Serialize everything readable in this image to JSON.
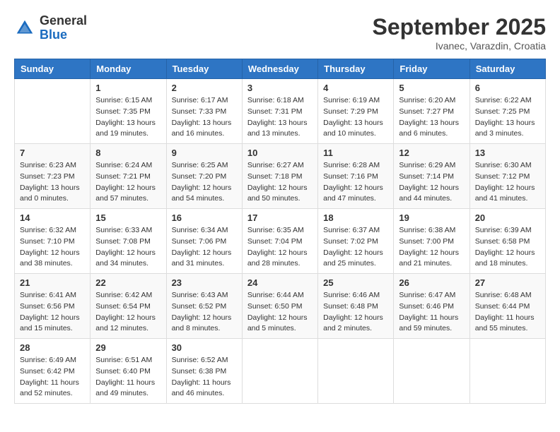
{
  "header": {
    "logo_general": "General",
    "logo_blue": "Blue",
    "month_title": "September 2025",
    "subtitle": "Ivanec, Varazdin, Croatia"
  },
  "weekdays": [
    "Sunday",
    "Monday",
    "Tuesday",
    "Wednesday",
    "Thursday",
    "Friday",
    "Saturday"
  ],
  "weeks": [
    [
      {
        "day": "",
        "info": ""
      },
      {
        "day": "1",
        "info": "Sunrise: 6:15 AM\nSunset: 7:35 PM\nDaylight: 13 hours\nand 19 minutes."
      },
      {
        "day": "2",
        "info": "Sunrise: 6:17 AM\nSunset: 7:33 PM\nDaylight: 13 hours\nand 16 minutes."
      },
      {
        "day": "3",
        "info": "Sunrise: 6:18 AM\nSunset: 7:31 PM\nDaylight: 13 hours\nand 13 minutes."
      },
      {
        "day": "4",
        "info": "Sunrise: 6:19 AM\nSunset: 7:29 PM\nDaylight: 13 hours\nand 10 minutes."
      },
      {
        "day": "5",
        "info": "Sunrise: 6:20 AM\nSunset: 7:27 PM\nDaylight: 13 hours\nand 6 minutes."
      },
      {
        "day": "6",
        "info": "Sunrise: 6:22 AM\nSunset: 7:25 PM\nDaylight: 13 hours\nand 3 minutes."
      }
    ],
    [
      {
        "day": "7",
        "info": "Sunrise: 6:23 AM\nSunset: 7:23 PM\nDaylight: 13 hours\nand 0 minutes."
      },
      {
        "day": "8",
        "info": "Sunrise: 6:24 AM\nSunset: 7:21 PM\nDaylight: 12 hours\nand 57 minutes."
      },
      {
        "day": "9",
        "info": "Sunrise: 6:25 AM\nSunset: 7:20 PM\nDaylight: 12 hours\nand 54 minutes."
      },
      {
        "day": "10",
        "info": "Sunrise: 6:27 AM\nSunset: 7:18 PM\nDaylight: 12 hours\nand 50 minutes."
      },
      {
        "day": "11",
        "info": "Sunrise: 6:28 AM\nSunset: 7:16 PM\nDaylight: 12 hours\nand 47 minutes."
      },
      {
        "day": "12",
        "info": "Sunrise: 6:29 AM\nSunset: 7:14 PM\nDaylight: 12 hours\nand 44 minutes."
      },
      {
        "day": "13",
        "info": "Sunrise: 6:30 AM\nSunset: 7:12 PM\nDaylight: 12 hours\nand 41 minutes."
      }
    ],
    [
      {
        "day": "14",
        "info": "Sunrise: 6:32 AM\nSunset: 7:10 PM\nDaylight: 12 hours\nand 38 minutes."
      },
      {
        "day": "15",
        "info": "Sunrise: 6:33 AM\nSunset: 7:08 PM\nDaylight: 12 hours\nand 34 minutes."
      },
      {
        "day": "16",
        "info": "Sunrise: 6:34 AM\nSunset: 7:06 PM\nDaylight: 12 hours\nand 31 minutes."
      },
      {
        "day": "17",
        "info": "Sunrise: 6:35 AM\nSunset: 7:04 PM\nDaylight: 12 hours\nand 28 minutes."
      },
      {
        "day": "18",
        "info": "Sunrise: 6:37 AM\nSunset: 7:02 PM\nDaylight: 12 hours\nand 25 minutes."
      },
      {
        "day": "19",
        "info": "Sunrise: 6:38 AM\nSunset: 7:00 PM\nDaylight: 12 hours\nand 21 minutes."
      },
      {
        "day": "20",
        "info": "Sunrise: 6:39 AM\nSunset: 6:58 PM\nDaylight: 12 hours\nand 18 minutes."
      }
    ],
    [
      {
        "day": "21",
        "info": "Sunrise: 6:41 AM\nSunset: 6:56 PM\nDaylight: 12 hours\nand 15 minutes."
      },
      {
        "day": "22",
        "info": "Sunrise: 6:42 AM\nSunset: 6:54 PM\nDaylight: 12 hours\nand 12 minutes."
      },
      {
        "day": "23",
        "info": "Sunrise: 6:43 AM\nSunset: 6:52 PM\nDaylight: 12 hours\nand 8 minutes."
      },
      {
        "day": "24",
        "info": "Sunrise: 6:44 AM\nSunset: 6:50 PM\nDaylight: 12 hours\nand 5 minutes."
      },
      {
        "day": "25",
        "info": "Sunrise: 6:46 AM\nSunset: 6:48 PM\nDaylight: 12 hours\nand 2 minutes."
      },
      {
        "day": "26",
        "info": "Sunrise: 6:47 AM\nSunset: 6:46 PM\nDaylight: 11 hours\nand 59 minutes."
      },
      {
        "day": "27",
        "info": "Sunrise: 6:48 AM\nSunset: 6:44 PM\nDaylight: 11 hours\nand 55 minutes."
      }
    ],
    [
      {
        "day": "28",
        "info": "Sunrise: 6:49 AM\nSunset: 6:42 PM\nDaylight: 11 hours\nand 52 minutes."
      },
      {
        "day": "29",
        "info": "Sunrise: 6:51 AM\nSunset: 6:40 PM\nDaylight: 11 hours\nand 49 minutes."
      },
      {
        "day": "30",
        "info": "Sunrise: 6:52 AM\nSunset: 6:38 PM\nDaylight: 11 hours\nand 46 minutes."
      },
      {
        "day": "",
        "info": ""
      },
      {
        "day": "",
        "info": ""
      },
      {
        "day": "",
        "info": ""
      },
      {
        "day": "",
        "info": ""
      }
    ]
  ]
}
